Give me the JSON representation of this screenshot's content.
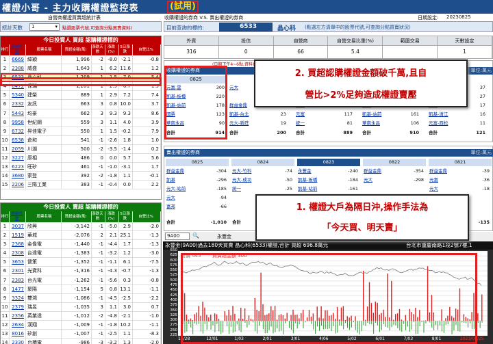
{
  "title": {
    "main": "權證小哥 - 主力收購權證監控表",
    "tag": "(試用)"
  },
  "sub": {
    "left_label": "自營商權證買賣超統計表",
    "right_label": "收購權證的券商 V.S. 賣出權證的券商",
    "date_label": "日期設定:",
    "date": "20230825"
  },
  "left_controls": {
    "days_label": "統計天數",
    "days_value": "1",
    "hint": "點選股票代號,可查詢分點買賣資料)"
  },
  "right_controls": {
    "stock_label": "目前查詢的標的:",
    "stock_code": "6533",
    "stock_name": "晶心科",
    "hint": "(點選左方清單中的股票代號,可查詢分點買賣狀況)"
  },
  "summary": {
    "headers": [
      "外資",
      "投信",
      "自營商",
      "自營交易比重(%)",
      "範圍交易",
      "天數設定"
    ],
    "values": [
      "316",
      "0",
      "66",
      "5.4",
      "",
      "1"
    ]
  },
  "buy_table": {
    "title": "今日投資人 買超 認購權證標的",
    "headers": [
      "排行",
      "股票代號",
      "股票名稱",
      "買超金額(萬)",
      "漲跌天數",
      "漲跌(%)",
      "5日漲跌",
      "自營比%"
    ],
    "rows": [
      [
        "1",
        "6669",
        "緯穎",
        "1,996",
        "-2",
        "-8.0",
        "-2.1",
        "-0.8"
      ],
      [
        "2",
        "2388",
        "威盛",
        "1,643",
        "1",
        "6.2",
        "11.6",
        "1.2"
      ],
      [
        "3",
        "6533",
        "晶心科",
        "1,209",
        "1",
        "1.5",
        "7.0",
        "5.4"
      ],
      [
        "4",
        "6472",
        "保瑞",
        "1,201",
        "1",
        "2.9",
        "-6.7",
        "1.9"
      ],
      [
        "5",
        "5340",
        "建榮",
        "889",
        "1",
        "2.9",
        "7.2",
        "7.4"
      ],
      [
        "6",
        "2332",
        "友訊",
        "663",
        "3",
        "0.8",
        "10.0",
        "3.7"
      ],
      [
        "7",
        "5443",
        "均豪",
        "662",
        "3",
        "9.3",
        "9.3",
        "8.6"
      ],
      [
        "8",
        "9958",
        "世紀鋼",
        "559",
        "3",
        "1.1",
        "4.0",
        "3.9"
      ],
      [
        "9",
        "6732",
        "昇佳電子",
        "550",
        "1",
        "1.5",
        "-0.2",
        "7.9"
      ],
      [
        "10",
        "6538",
        "倉和",
        "541",
        "-1",
        "-2.6",
        "1.8",
        "1.0"
      ],
      [
        "11",
        "2059",
        "川湖",
        "500",
        "-2",
        "-3.5",
        "-1.4",
        "0.2"
      ],
      [
        "12",
        "3227",
        "原相",
        "486",
        "0",
        "0.0",
        "5.7",
        "5.6"
      ],
      [
        "13",
        "6223",
        "旺矽",
        "461",
        "-1",
        "-1.0",
        "-3.1",
        "1.7"
      ],
      [
        "14",
        "3680",
        "家登",
        "392",
        "-2",
        "-1.8",
        "1.1",
        "-0.1"
      ],
      [
        "15",
        "2206",
        "三陽工業",
        "383",
        "-1",
        "-0.4",
        "0.0",
        "2.2"
      ]
    ]
  },
  "sell_table": {
    "title": "今日投資人 賣超 認購權證標的",
    "headers": [
      "排行",
      "股票代號",
      "股票名稱",
      "買超金額(萬)",
      "漲跌天數",
      "漲跌(%)",
      "5日漲跌",
      "自營比%"
    ],
    "rows": [
      [
        "1",
        "3037",
        "欣興",
        "-3,142",
        "-1",
        "-5.0",
        "2.9",
        "-2.0"
      ],
      [
        "2",
        "1519",
        "華城",
        "-2,076",
        "2",
        "2.1",
        "25.1",
        "-1.3"
      ],
      [
        "3",
        "2368",
        "金像電",
        "-1,440",
        "-1",
        "-4.4",
        "1.7",
        "-1.3"
      ],
      [
        "4",
        "2308",
        "台達電",
        "-1,383",
        "-1",
        "-3.2",
        "1.2",
        "-3.0"
      ],
      [
        "5",
        "3653",
        "健策",
        "-1,352",
        "-1",
        "-1.1",
        "6.1",
        "-7.5"
      ],
      [
        "6",
        "2301",
        "光寶科",
        "-1,316",
        "-1",
        "-4.3",
        "-0.7",
        "-1.3"
      ],
      [
        "7",
        "2383",
        "台光電",
        "-1,262",
        "-1",
        "-5.6",
        "0.3",
        "-0.8"
      ],
      [
        "8",
        "1477",
        "聚陽",
        "-1,154",
        "5",
        "0.8",
        "13.1",
        "-1.1"
      ],
      [
        "9",
        "3324",
        "雙鴻",
        "-1,086",
        "-1",
        "-4.5",
        "-2.5",
        "-2.2"
      ],
      [
        "10",
        "2379",
        "瑞昱",
        "-1,035",
        "3",
        "1.1",
        "3.0",
        "0.7"
      ],
      [
        "11",
        "2356",
        "英業達",
        "-1,012",
        "-2",
        "-4.8",
        "-2.1",
        "-1.0"
      ],
      [
        "12",
        "2634",
        "漢翔",
        "-1,009",
        "-1",
        "-1.8",
        "10.2",
        "-1.1"
      ],
      [
        "13",
        "8016",
        "矽創",
        "-1,007",
        "-1",
        "-2.5",
        "1.1",
        "-8.3"
      ],
      [
        "14",
        "2330",
        "台積電",
        "-986",
        "-3",
        "-3.2",
        "1.3",
        "-2.0"
      ]
    ]
  },
  "buy_brokers": {
    "title": "收購權證的券商",
    "unit": "單位:萬元",
    "date": "0825",
    "note": "(日期下午4~6點,資料更新)",
    "left": [
      [
        "元富.雲",
        "300"
      ],
      [
        "凱基-板橋",
        "220"
      ],
      [
        "凱基-站前",
        "178"
      ],
      [
        "國票",
        "123"
      ],
      [
        "華南永昌",
        "90"
      ]
    ],
    "left_total": [
      "合計",
      "914"
    ],
    "cols": [
      {
        "rows": [
          [
            "元大",
            "63"
          ],
          [
            "",
            "200"
          ],
          [
            "群益金鼎",
            "41"
          ],
          [
            "凱基-台北",
            "23"
          ],
          [
            "元大-新莊",
            "19"
          ]
        ],
        "total": [
          "合計",
          "200"
        ]
      },
      {
        "rows": [
          [
            "元大",
            "163"
          ],
          [
            "",
            "114"
          ],
          [
            "元大",
            "131"
          ],
          [
            "元富",
            "117"
          ],
          [
            "統一",
            "81"
          ]
        ],
        "total": [
          "合計",
          "889"
        ]
      },
      {
        "rows": [
          [
            "凱基",
            "222"
          ],
          [
            "",
            "165"
          ],
          [
            "國票",
            "184"
          ],
          [
            "凱基-站前",
            "161"
          ],
          [
            "華南永昌",
            "106"
          ]
        ],
        "total": [
          "合計",
          "910"
        ]
      },
      {
        "rows": [
          [
            "元大",
            "37"
          ],
          [
            "",
            "27"
          ],
          [
            "統一",
            "17"
          ],
          [
            "凱基-清江",
            "16"
          ],
          [
            "元富-西松",
            "11"
          ]
        ],
        "total": [
          "合計",
          "121"
        ]
      }
    ]
  },
  "sell_brokers": {
    "title": "賣出權證的券商",
    "unit": "單位:萬元",
    "dates": [
      "0825",
      "0824",
      "0823",
      "0822",
      "0821"
    ],
    "cols": [
      [
        [
          "群益金鼎",
          "-304"
        ],
        [
          "凱基",
          "-296"
        ],
        [
          "元大-站前",
          "-185"
        ],
        [
          "元大",
          "-94"
        ],
        [
          "富邦",
          "-66"
        ]
      ],
      [
        [
          "元大-竹科",
          "-74"
        ],
        [
          "元大-成功",
          "-50"
        ],
        [
          "統一",
          "-25"
        ],
        [
          "",
          ""
        ],
        [
          "",
          ""
        ]
      ],
      [
        [
          "永豐金",
          "-240"
        ],
        [
          "凱基-板橋",
          "-184"
        ],
        [
          "凱基-站前",
          "-161"
        ],
        [
          "",
          ""
        ],
        [
          "",
          ""
        ]
      ],
      [
        [
          "群益金鼎",
          "-354"
        ],
        [
          "元大",
          "-298"
        ],
        [
          "",
          ""
        ],
        [
          "",
          ""
        ],
        [
          "",
          ""
        ]
      ],
      [
        [
          "群益金鼎",
          "-39"
        ],
        [
          "元富",
          "-36"
        ],
        [
          "元大",
          "-18"
        ],
        [
          "",
          ""
        ],
        [
          "",
          ""
        ]
      ]
    ],
    "totals": [
      "-1,010",
      "",
      "",
      "",
      "-135"
    ],
    "total_label": "合計"
  },
  "toolbar": {
    "code": "9A00",
    "zoom": "Q",
    "broker": "永豐金"
  },
  "chart_header": {
    "text": "永豐金(9A00)過去180天買賣 晶心科(6533)權證,合計 買超 696.8萬元",
    "address": "台北市重慶南路1段2號7樓,1"
  },
  "chart_data": {
    "type": "line",
    "title": "",
    "legend": [
      "股價 445",
      "買賣超金額 300"
    ],
    "ylim": [
      225,
      650
    ],
    "yticks": [
      225,
      250,
      275,
      300,
      325,
      350,
      375,
      400,
      425,
      450,
      475,
      500,
      525,
      550,
      575,
      600,
      625,
      650
    ],
    "xticks": [
      "11/28",
      "12/01",
      "1/03",
      "2/01",
      "3/01",
      "4/06",
      "5/02",
      "6/01",
      "7/03",
      "8/01",
      "2023/08/25"
    ]
  },
  "callout1": {
    "line1": "2.  買超認購權證金額破千萬,且自",
    "line2": "營比>2%足夠造成權證賣壓"
  },
  "callout2": {
    "line1": "1.  權證大戶為隔日沖,操作手法為",
    "line2": "「今天買、明天賣」"
  },
  "colors": {
    "header_blue": "#1f4e8c",
    "buy_red": "#c00000",
    "sell_green": "#0c7a0c",
    "callout_red": "#c00000"
  }
}
